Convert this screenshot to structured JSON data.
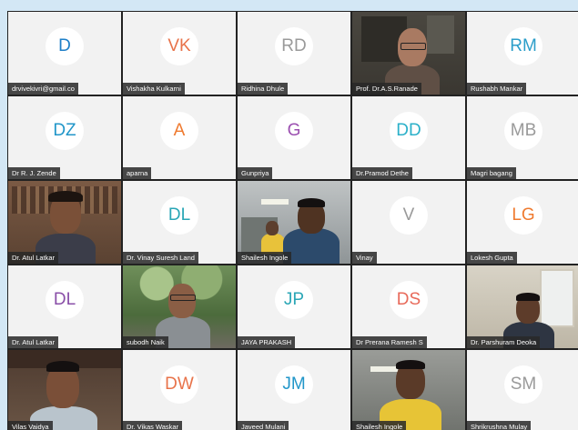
{
  "participants": [
    {
      "name": "drvivekivri@gmail.co",
      "initials": "D",
      "color": "#1e7fc8",
      "video": false
    },
    {
      "name": "Vishakha Kulkarni",
      "initials": "VK",
      "color": "#e8734a",
      "video": false
    },
    {
      "name": "Ridhina Dhule",
      "initials": "RD",
      "color": "#9a9a9a",
      "video": false
    },
    {
      "name": "Prof. Dr.A.S.Ranade",
      "initials": "",
      "color": "",
      "video": true
    },
    {
      "name": "Rushabh Mankar",
      "initials": "RM",
      "color": "#2b9ec9",
      "video": false
    },
    {
      "name": "Dr R. J. Zende",
      "initials": "DZ",
      "color": "#2196c9",
      "video": false
    },
    {
      "name": "aparna",
      "initials": "A",
      "color": "#ef7a2f",
      "video": false
    },
    {
      "name": "Gunpriya",
      "initials": "G",
      "color": "#9b4fb0",
      "video": false
    },
    {
      "name": "Dr.Pramod Dethe",
      "initials": "DD",
      "color": "#2bb0c9",
      "video": false
    },
    {
      "name": "Magri bagang",
      "initials": "MB",
      "color": "#9a9a9a",
      "video": false
    },
    {
      "name": "Dr. Atul Latkar",
      "initials": "",
      "color": "",
      "video": true
    },
    {
      "name": "Dr. Vinay Suresh Land",
      "initials": "DL",
      "color": "#2aa6b6",
      "video": false
    },
    {
      "name": "Shailesh Ingole",
      "initials": "",
      "color": "",
      "video": true
    },
    {
      "name": "Vinay",
      "initials": "V",
      "color": "#9a9a9a",
      "video": false
    },
    {
      "name": "Lokesh Gupta",
      "initials": "LG",
      "color": "#ef7a2f",
      "video": false
    },
    {
      "name": "Dr. Atul Latkar",
      "initials": "DL",
      "color": "#8a4fa8",
      "video": false
    },
    {
      "name": "subodh Naik",
      "initials": "",
      "color": "",
      "video": true
    },
    {
      "name": "JAYA PRAKASH",
      "initials": "JP",
      "color": "#2aa6b6",
      "video": false
    },
    {
      "name": "Dr Prerana Ramesh S",
      "initials": "DS",
      "color": "#e86a5a",
      "video": false
    },
    {
      "name": "Dr. Parshuram Deoka",
      "initials": "",
      "color": "",
      "video": true
    },
    {
      "name": "Vilas Vaidya",
      "initials": "",
      "color": "",
      "video": true
    },
    {
      "name": "Dr. Vikas Waskar",
      "initials": "DW",
      "color": "#e8734a",
      "video": false
    },
    {
      "name": "Javeed Mulani",
      "initials": "JM",
      "color": "#2196c9",
      "video": false
    },
    {
      "name": "Shailesh Ingole",
      "initials": "",
      "color": "",
      "video": true
    },
    {
      "name": "Shrikrushna Mulay",
      "initials": "SM",
      "color": "#9a9a9a",
      "video": false
    }
  ]
}
